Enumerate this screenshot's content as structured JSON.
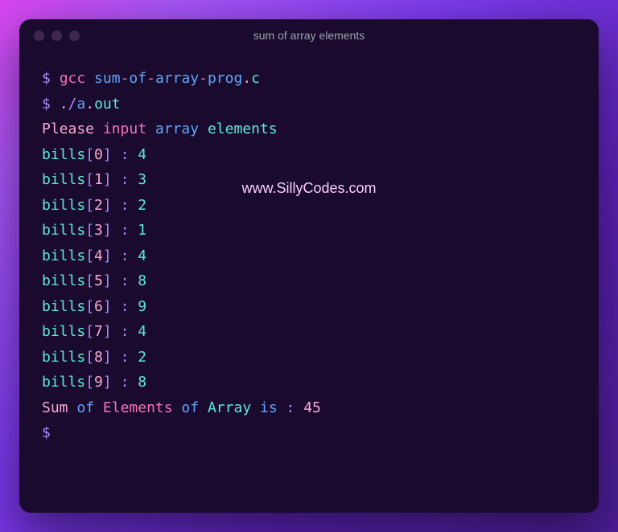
{
  "title": "sum of array elements",
  "watermark": "www.SillyCodes.com",
  "prompt": "$",
  "cmd1": {
    "gcc": "gcc",
    "file_base": "sum",
    "dash": "-",
    "of": "of",
    "array": "array",
    "prog": "prog",
    "dot": ".",
    "ext": "c"
  },
  "cmd2": {
    "dot": ".",
    "slash": "/",
    "a": "a",
    "dot2": ".",
    "out": "out"
  },
  "inputPrompt": {
    "please": "Please",
    "input": "input",
    "array": "array",
    "elements": "elements"
  },
  "arrayName": "bills",
  "entries": [
    {
      "idx": "0",
      "val": "4"
    },
    {
      "idx": "1",
      "val": "3"
    },
    {
      "idx": "2",
      "val": "2"
    },
    {
      "idx": "3",
      "val": "1"
    },
    {
      "idx": "4",
      "val": "4"
    },
    {
      "idx": "5",
      "val": "8"
    },
    {
      "idx": "6",
      "val": "9"
    },
    {
      "idx": "7",
      "val": "4"
    },
    {
      "idx": "8",
      "val": "2"
    },
    {
      "idx": "9",
      "val": "8"
    }
  ],
  "result": {
    "sum": "Sum",
    "of1": "of",
    "elements": "Elements",
    "of2": "of",
    "array": "Array",
    "is": "is",
    "colon": ":",
    "value": "45"
  }
}
